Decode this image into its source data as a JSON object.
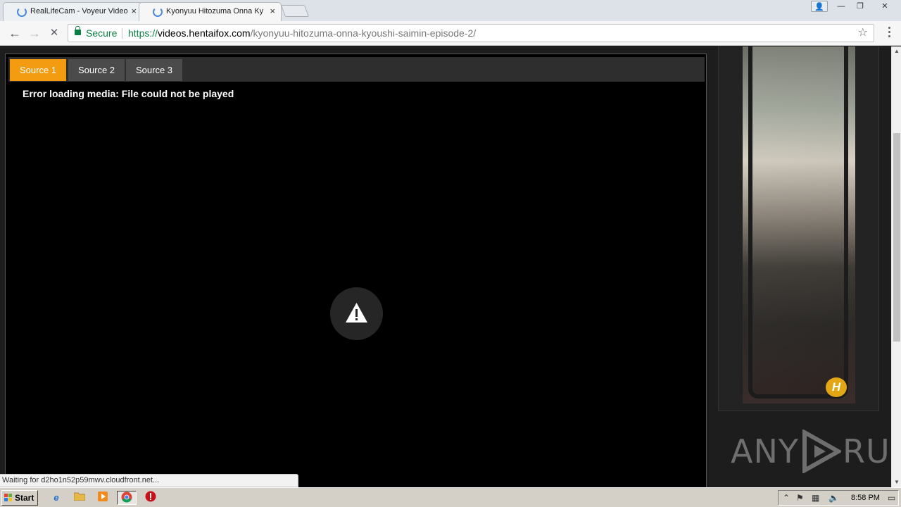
{
  "browser": {
    "tabs": [
      {
        "title": "RealLifeCam - Voyeur Video",
        "active": false
      },
      {
        "title": "Kyonyuu Hitozuma Onna Ky",
        "active": true
      }
    ],
    "tab_close_glyph": "×",
    "window_controls": {
      "user": "👤",
      "minimize": "—",
      "restore": "❐",
      "close": "✕"
    },
    "nav": {
      "back": "←",
      "forward": "→",
      "stop": "✕"
    },
    "omnibox": {
      "secure_label": "Secure",
      "scheme": "https://",
      "host": "videos.hentaifox.com",
      "path": "/kyonyuu-hitozuma-onna-kyoushi-saimin-episode-2/",
      "bookmark_glyph": "☆"
    }
  },
  "player": {
    "source_tabs": [
      {
        "label": "Source 1",
        "active": true
      },
      {
        "label": "Source 2",
        "active": false
      },
      {
        "label": "Source 3",
        "active": false
      }
    ],
    "error_message": "Error loading media: File could not be played",
    "error_icon": "warning-triangle-icon"
  },
  "sidebar": {
    "ad_logo_text": "H"
  },
  "watermark": {
    "left": "ANY",
    "right": "RUN"
  },
  "status_bubble": "Waiting for d2ho1n52p59mwv.cloudfront.net...",
  "taskbar": {
    "start_label": "Start",
    "clock": "8:58 PM"
  },
  "colors": {
    "source_active": "#f39c12",
    "source_inactive": "#4b4b4b",
    "secure_green": "#0b8043"
  }
}
